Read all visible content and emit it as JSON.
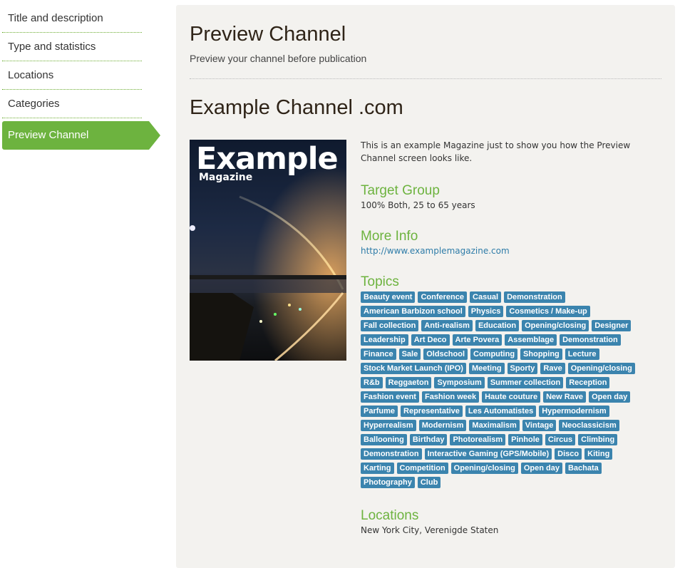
{
  "sidebar": {
    "items": [
      {
        "label": "Title and description"
      },
      {
        "label": "Type and statistics"
      },
      {
        "label": "Locations"
      },
      {
        "label": "Categories"
      },
      {
        "label": "Preview Channel",
        "active": true
      }
    ]
  },
  "main": {
    "title": "Preview Channel",
    "subtitle": "Preview your channel before publication",
    "channel_name": "Example Channel .com",
    "cover": {
      "title": "Example",
      "subtitle": "Magazine"
    },
    "description": "This is an example Magazine just to show you how the Preview Channel screen looks like.",
    "target_group": {
      "heading": "Target Group",
      "value": "100% Both, 25 to 65 years"
    },
    "more_info": {
      "heading": "More Info",
      "url": "http://www.examplemagazine.com"
    },
    "topics": {
      "heading": "Topics",
      "tags": [
        "Beauty event",
        "Conference",
        "Casual",
        "Demonstration",
        "American Barbizon school",
        "Physics",
        "Cosmetics / Make-up",
        "Fall collection",
        "Anti-realism",
        "Education",
        "Opening/closing",
        "Designer",
        "Leadership",
        "Art Deco",
        "Arte Povera",
        "Assemblage",
        "Demonstration",
        "Finance",
        "Sale",
        "Oldschool",
        "Computing",
        "Shopping",
        "Lecture",
        "Stock Market Launch (IPO)",
        "Meeting",
        "Sporty",
        "Rave",
        "Opening/closing",
        "R&b",
        "Reggaeton",
        "Symposium",
        "Summer collection",
        "Reception",
        "Fashion event",
        "Fashion week",
        "Haute couture",
        "New Rave",
        "Open day",
        "Parfume",
        "Representative",
        "Les Automatistes",
        "Hypermodernism",
        "Hyperrealism",
        "Modernism",
        "Maximalism",
        "Vintage",
        "Neoclassicism",
        "Ballooning",
        "Birthday",
        "Photorealism",
        "Pinhole",
        "Circus",
        "Climbing",
        "Demonstration",
        "Interactive Gaming (GPS/Mobile)",
        "Disco",
        "Kiting",
        "Karting",
        "Competition",
        "Opening/closing",
        "Open day",
        "Bachata",
        "Photography",
        "Club"
      ]
    },
    "locations": {
      "heading": "Locations",
      "value": "New York City, Verenigde Staten"
    }
  },
  "colors": {
    "accent": "#6db33f",
    "tag": "#3b84ae",
    "link": "#2e7ca8",
    "panel": "#f3f2ef"
  }
}
